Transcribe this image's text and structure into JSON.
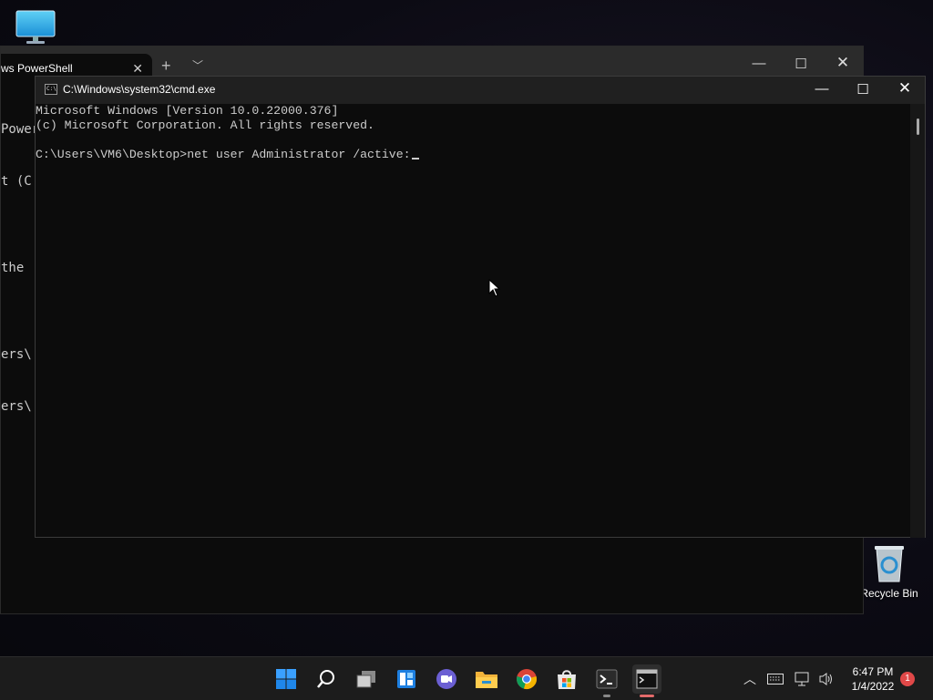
{
  "desktop": {
    "icons": [
      {
        "name": "this-pc",
        "label": ""
      },
      {
        "name": "recycle-bin",
        "label": "Recycle Bin"
      }
    ]
  },
  "terminal_window": {
    "tab_title": "ws PowerShell",
    "visible_lines": [
      "Power",
      "t (C",
      "",
      "the ",
      "",
      "ers\\",
      "ers\\"
    ]
  },
  "cmd_window": {
    "title": "C:\\Windows\\system32\\cmd.exe",
    "lines": [
      "Microsoft Windows [Version 10.0.22000.376]",
      "(c) Microsoft Corporation. All rights reserved.",
      "",
      "C:\\Users\\VM6\\Desktop>net user Administrator /active:"
    ]
  },
  "taskbar": {
    "items": [
      "start",
      "search",
      "task-view",
      "widgets",
      "chat",
      "file-explorer",
      "chrome",
      "store",
      "terminal",
      "cmd"
    ],
    "time": "6:47 PM",
    "date": "1/4/2022",
    "notification_count": "1"
  },
  "colors": {
    "terminal_bg": "#0c0c0c",
    "text": "#cccccc",
    "taskbar_bg": "#1c1c1c",
    "accent": "#0078d4"
  }
}
